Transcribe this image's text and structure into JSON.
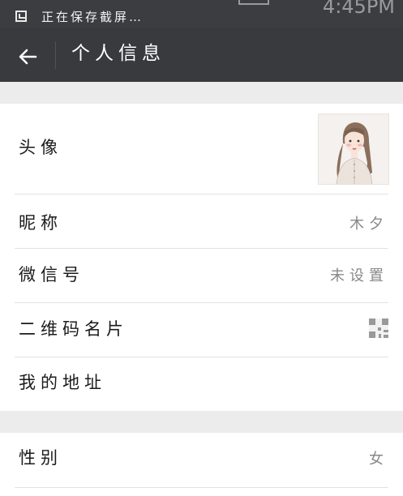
{
  "status_bar": {
    "notification_text": "正在保存截屏…",
    "time": "4:45PM"
  },
  "header": {
    "title": "个人信息",
    "back_icon": "back-arrow-icon"
  },
  "colors": {
    "header_bg": "#393a3e",
    "section_gap": "#ececec",
    "value_text": "#888888"
  },
  "section1": [
    {
      "label": "头像",
      "value": "",
      "type": "avatar"
    },
    {
      "label": "昵称",
      "value": "木夕"
    },
    {
      "label": "微信号",
      "value": "未设置"
    },
    {
      "label": "二维码名片",
      "value": "",
      "type": "qr-code"
    },
    {
      "label": "我的地址",
      "value": ""
    }
  ],
  "section2": [
    {
      "label": "性别",
      "value": "女"
    }
  ]
}
